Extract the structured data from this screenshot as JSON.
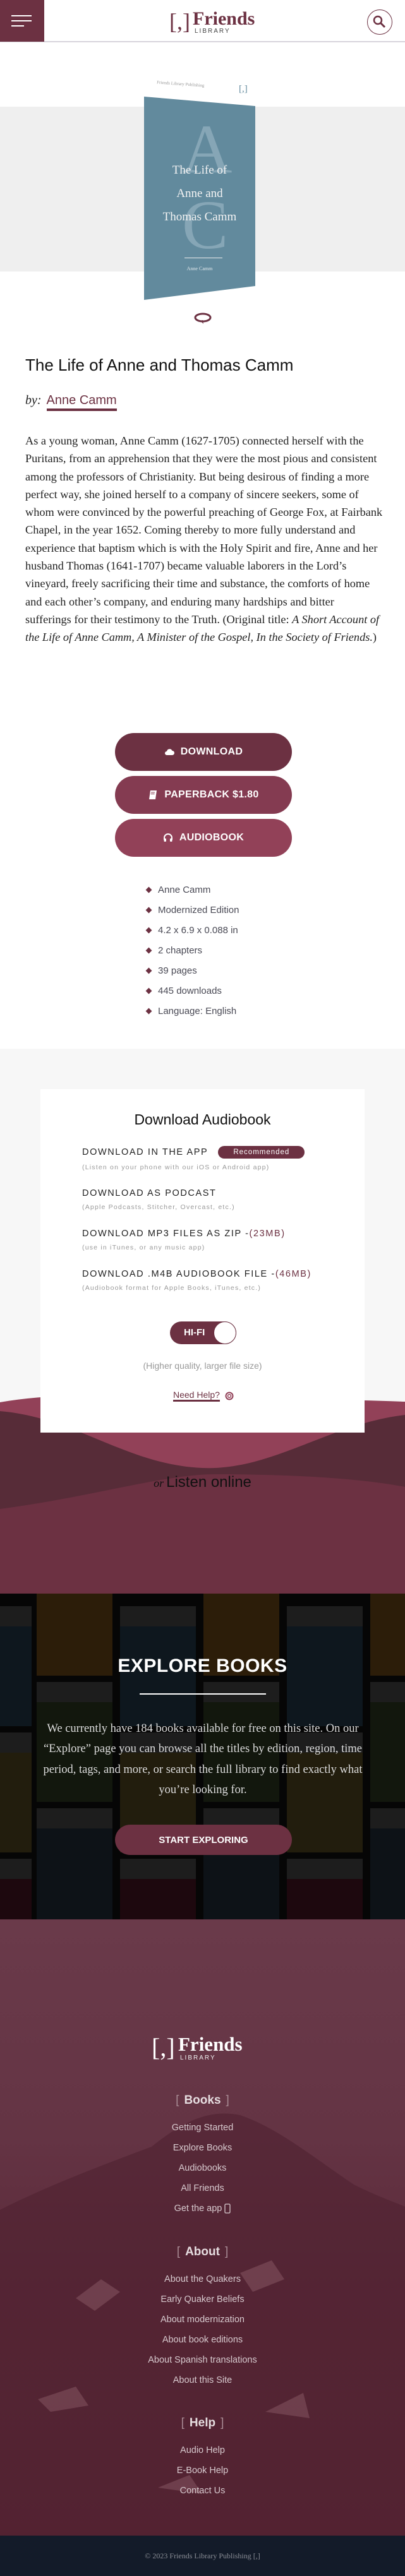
{
  "header": {
    "logo_brackets": "[,]",
    "logo_name": "Friends",
    "logo_sub": "LIBRARY",
    "menu_icon": "hamburger-icon",
    "search_icon": "search-icon"
  },
  "cover": {
    "publisher": "Friends Library Publishing",
    "mark": "[,]",
    "initial_1": "A",
    "initial_2": "C",
    "title_lines": [
      "The Life of",
      "Anne and",
      "Thomas Camm"
    ],
    "author": "Anne Camm",
    "color": "#628a9d"
  },
  "book": {
    "title": "The Life of Anne and Thomas Camm",
    "by_label": "by:",
    "author": "Anne Camm",
    "description_main": "As a young woman, Anne Camm (1627-1705) connected herself with the Puritans, from an apprehension that they were the most pious and consistent among the professors of Christianity. But being desirous of finding a more perfect way, she joined herself to a company of sincere seekers, some of whom were convinced by the powerful preaching of George Fox, at Fairbank Chapel, in the year 1652. Coming thereby to more fully understand and experience that baptism which is with the Holy Spirit and fire, Anne and her husband Thomas (1641-1707) became valuable laborers in the Lord’s vineyard, freely sacrificing their time and substance, the comforts of home and each other’s company, and enduring many hardships and bitter sufferings for their testimony to the Truth. (Original title: ",
    "original_title": "A Short Account of the Life of Anne Camm, A Minister of the Gospel, In the Society of Friends.",
    "description_end": ")"
  },
  "buttons": {
    "download": "DOWNLOAD",
    "paperback": "PAPERBACK $1.80",
    "audiobook": "AUDIOBOOK"
  },
  "meta": [
    "Anne Camm",
    "Modernized Edition",
    "4.2 x 6.9 x 0.088 in",
    "2 chapters",
    "39 pages",
    "445 downloads",
    "Language: English"
  ],
  "audio": {
    "title": "Download Audiobook",
    "options": [
      {
        "label": "DOWNLOAD IN THE APP",
        "badge": "Recommended",
        "sub": "(Listen on your phone with our iOS or Android app)"
      },
      {
        "label": "DOWNLOAD AS PODCAST",
        "sub": "(Apple Podcasts, Stitcher, Overcast, etc.)"
      },
      {
        "label": "DOWNLOAD MP3 FILES AS ZIP - ",
        "size": "(23MB)",
        "sub": "(use in iTunes, or any music app)"
      },
      {
        "label": "DOWNLOAD .M4B AUDIOBOOK FILE - ",
        "size": "(46MB)",
        "sub": "(Audiobook format for Apple Books, iTunes, etc.)"
      }
    ],
    "toggle_label": "HI-FI",
    "toggle_on": true,
    "quality_note": "(Higher quality, larger file size)",
    "help": "Need Help?",
    "or": "or",
    "listen_online": "Listen online"
  },
  "explore": {
    "title": "EXPLORE BOOKS",
    "text": "We currently have 184 books available for free on this site. On our “Explore” page you can browse all the titles by edition, region, time period, tags, and more, or search the full library to find exactly what you’re looking for.",
    "button": "START EXPLORING"
  },
  "footer": {
    "logo_brackets": "[,]",
    "logo_name": "Friends",
    "logo_sub": "LIBRARY",
    "sections": [
      {
        "title": "Books",
        "links": [
          "Getting Started",
          "Explore Books",
          "Audiobooks",
          "All Friends",
          "Get the app"
        ]
      },
      {
        "title": "About",
        "links": [
          "About the Quakers",
          "Early Quaker Beliefs",
          "About modernization",
          "About book editions",
          "About Spanish translations",
          "About this Site"
        ]
      },
      {
        "title": "Help",
        "links": [
          "Audio Help",
          "E-Book Help",
          "Contact Us"
        ]
      }
    ],
    "copyright": "© 2023 Friends Library Publishing [,]"
  },
  "colors": {
    "brand": "#6c3142",
    "paperback": "#843b51",
    "audiobook": "#924158",
    "footer_bar": "#131b29"
  }
}
